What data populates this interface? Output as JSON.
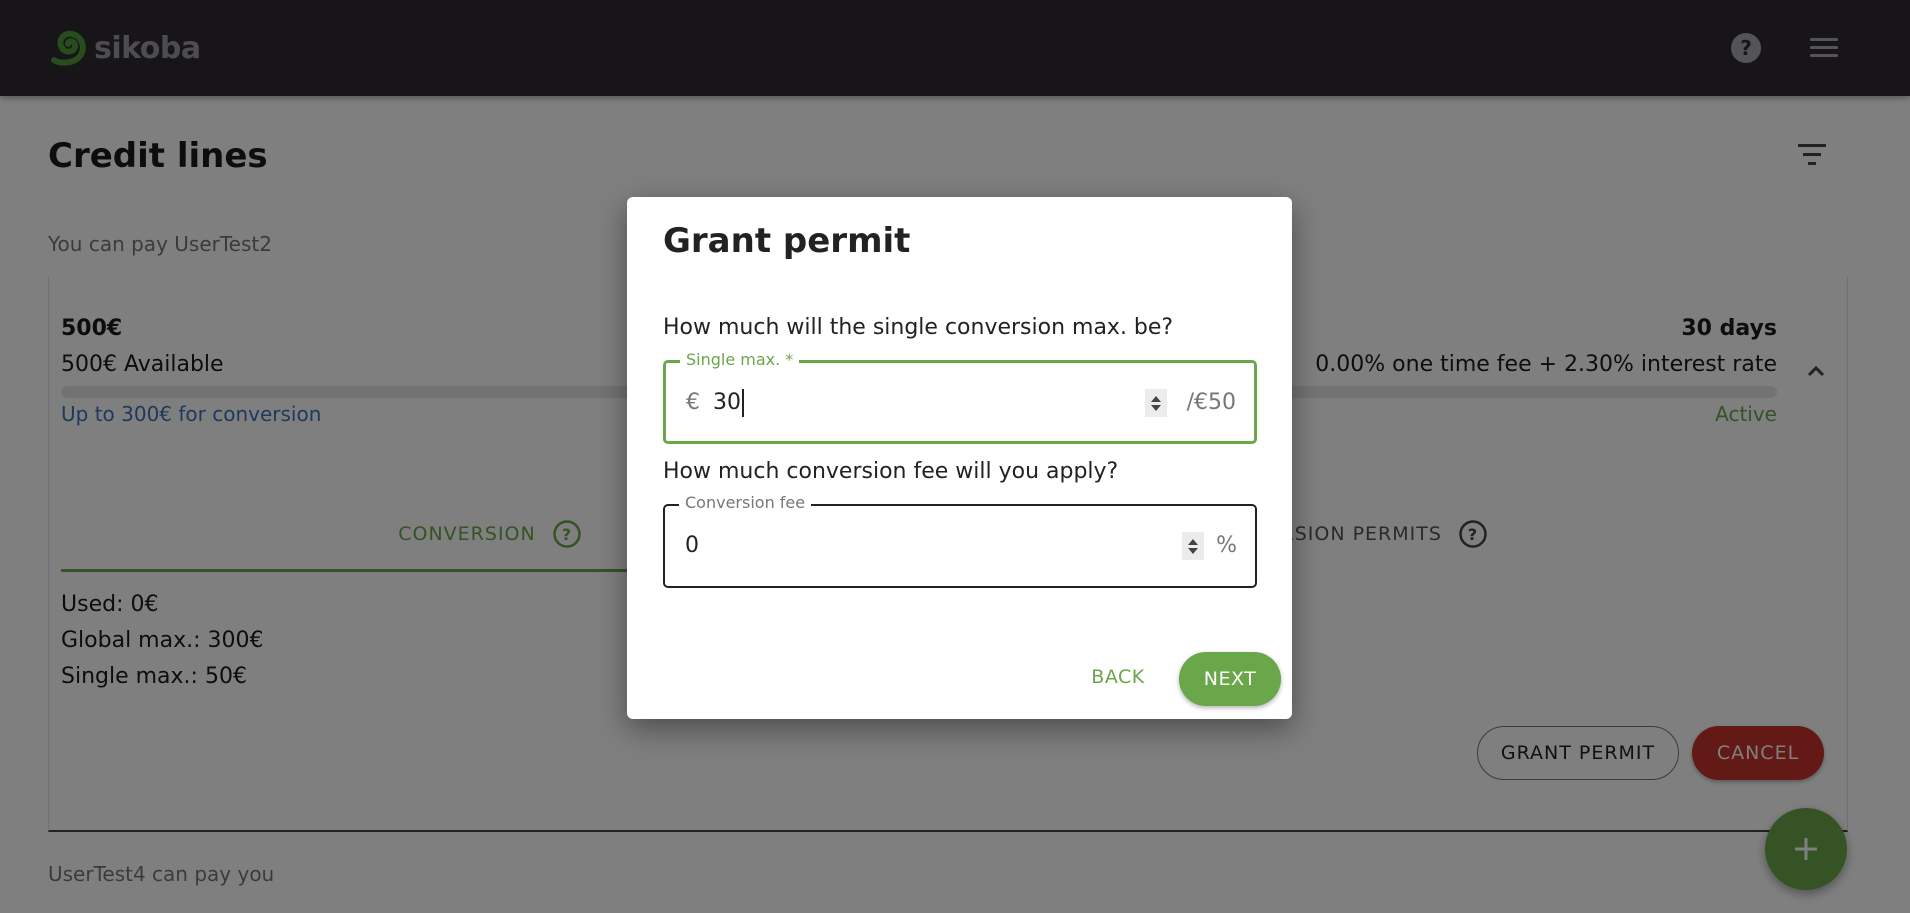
{
  "header": {
    "brand": "sikoba",
    "help_icon": "help-circle-icon",
    "menu_icon": "hamburger-menu-icon"
  },
  "page": {
    "title": "Credit lines",
    "filter_icon": "filter-list-icon",
    "section_outgoing_label": "You can pay UserTest2",
    "section_incoming_label": "UserTest4 can pay you"
  },
  "credit_line": {
    "amount": "500€",
    "available": "500€ Available",
    "used_fraction": 0,
    "conversion_link": "Up to 300€ for conversion",
    "duration": "30 days",
    "fees": "0.00% one time fee + 2.30% interest rate",
    "status": "Active",
    "collapse_icon": "chevron-up-icon",
    "tabs": [
      {
        "label": "CONVERSION",
        "active": true,
        "icon": "help-circle-outline-icon"
      },
      {
        "label": "CONVERSION PERMITS",
        "active": false,
        "icon": "help-circle-outline-icon"
      }
    ],
    "conversion_info": {
      "used": "Used: 0€",
      "global_max": "Global max.: 300€",
      "single_max": "Single max.: 50€"
    },
    "actions": {
      "grant_permit": "GRANT PERMIT",
      "cancel": "CANCEL"
    }
  },
  "fab": {
    "icon": "plus-icon"
  },
  "dialog": {
    "title": "Grant permit",
    "question_single_max": "How much will the single conversion max. be?",
    "single_max_field": {
      "label": "Single max. *",
      "prefix": "€",
      "value": "30",
      "suffix": "/€50"
    },
    "question_fee": "How much conversion fee will you apply?",
    "fee_field": {
      "label": "Conversion fee",
      "value": "0",
      "suffix": "%"
    },
    "back_label": "BACK",
    "next_label": "NEXT"
  },
  "colors": {
    "appbar": "#302b33",
    "accent_green": "#6aa64a",
    "danger_red": "#c6322b",
    "link_blue": "#3f73b8"
  }
}
